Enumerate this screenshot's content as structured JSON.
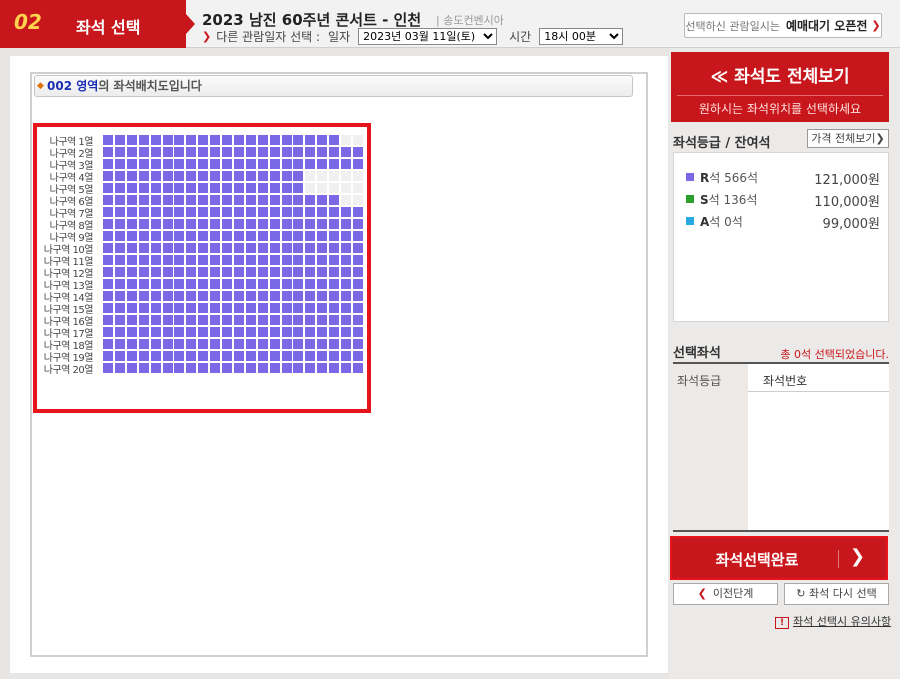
{
  "header": {
    "step_number": "02",
    "step_title": "좌석 선택",
    "event_title": "2023 남진 60주년 콘서트 - 인천",
    "venue": "| 송도컨벤시아",
    "other_date_label": "다른 관람일자 선택 :",
    "date_label": "일자",
    "date_value": "2023년 03월 11일(토)",
    "time_label": "시간",
    "time_value": "18시 00분",
    "notify_prefix": "선택하신 관람일시는",
    "notify_bold": "예매대기 오픈전"
  },
  "seat_area": {
    "zone_label": "002 영역",
    "zone_suffix": "의 좌석배치도입니다",
    "rows": [
      "나구역 1열",
      "나구역 2열",
      "나구역 3열",
      "나구역 4열",
      "나구역 5열",
      "나구역 6열",
      "나구역 7열",
      "나구역 8열",
      "나구역 9열",
      "나구역 10열",
      "나구역 11열",
      "나구역 12열",
      "나구역 13열",
      "나구역 14열",
      "나구역 15열",
      "나구역 16열",
      "나구역 17열",
      "나구역 18열",
      "나구역 19열",
      "나구역 20열"
    ],
    "seats_per_row": 22,
    "available_per_row": [
      20,
      22,
      22,
      17,
      17,
      20,
      22,
      22,
      22,
      22,
      22,
      22,
      22,
      22,
      22,
      22,
      22,
      22,
      22,
      22
    ]
  },
  "right_panel": {
    "full_view_label": "좌석도 전체보기",
    "full_view_sub": "원하시는 좌석위치를 선택하세요",
    "grade_heading": "좌석등급 / 잔여석",
    "price_all_label": "가격 전체보기",
    "grades": [
      {
        "letter": "R",
        "label": "석 566석",
        "price": "121,000원",
        "color": "#7b68e6"
      },
      {
        "letter": "S",
        "label": "석 136석",
        "price": "110,000원",
        "color": "#2ca02c"
      },
      {
        "letter": "A",
        "label": "석 0석",
        "price": "99,000원",
        "color": "#29a9e1"
      }
    ],
    "selected_heading": "선택좌석",
    "selected_count": "총 0석 선택되었습니다.",
    "col_grade": "좌석등급",
    "col_number": "좌석번호",
    "complete_label": "좌석선택완료",
    "prev_label": "이전단계",
    "reset_label": "좌석 다시 선택",
    "notice_label": "좌석 선택시 유의사항"
  },
  "colors": {
    "accent": "#c8171c",
    "seat_available": "#7b68e6",
    "seat_taken": "#f0f0f0",
    "map_border": "#e8141b"
  }
}
